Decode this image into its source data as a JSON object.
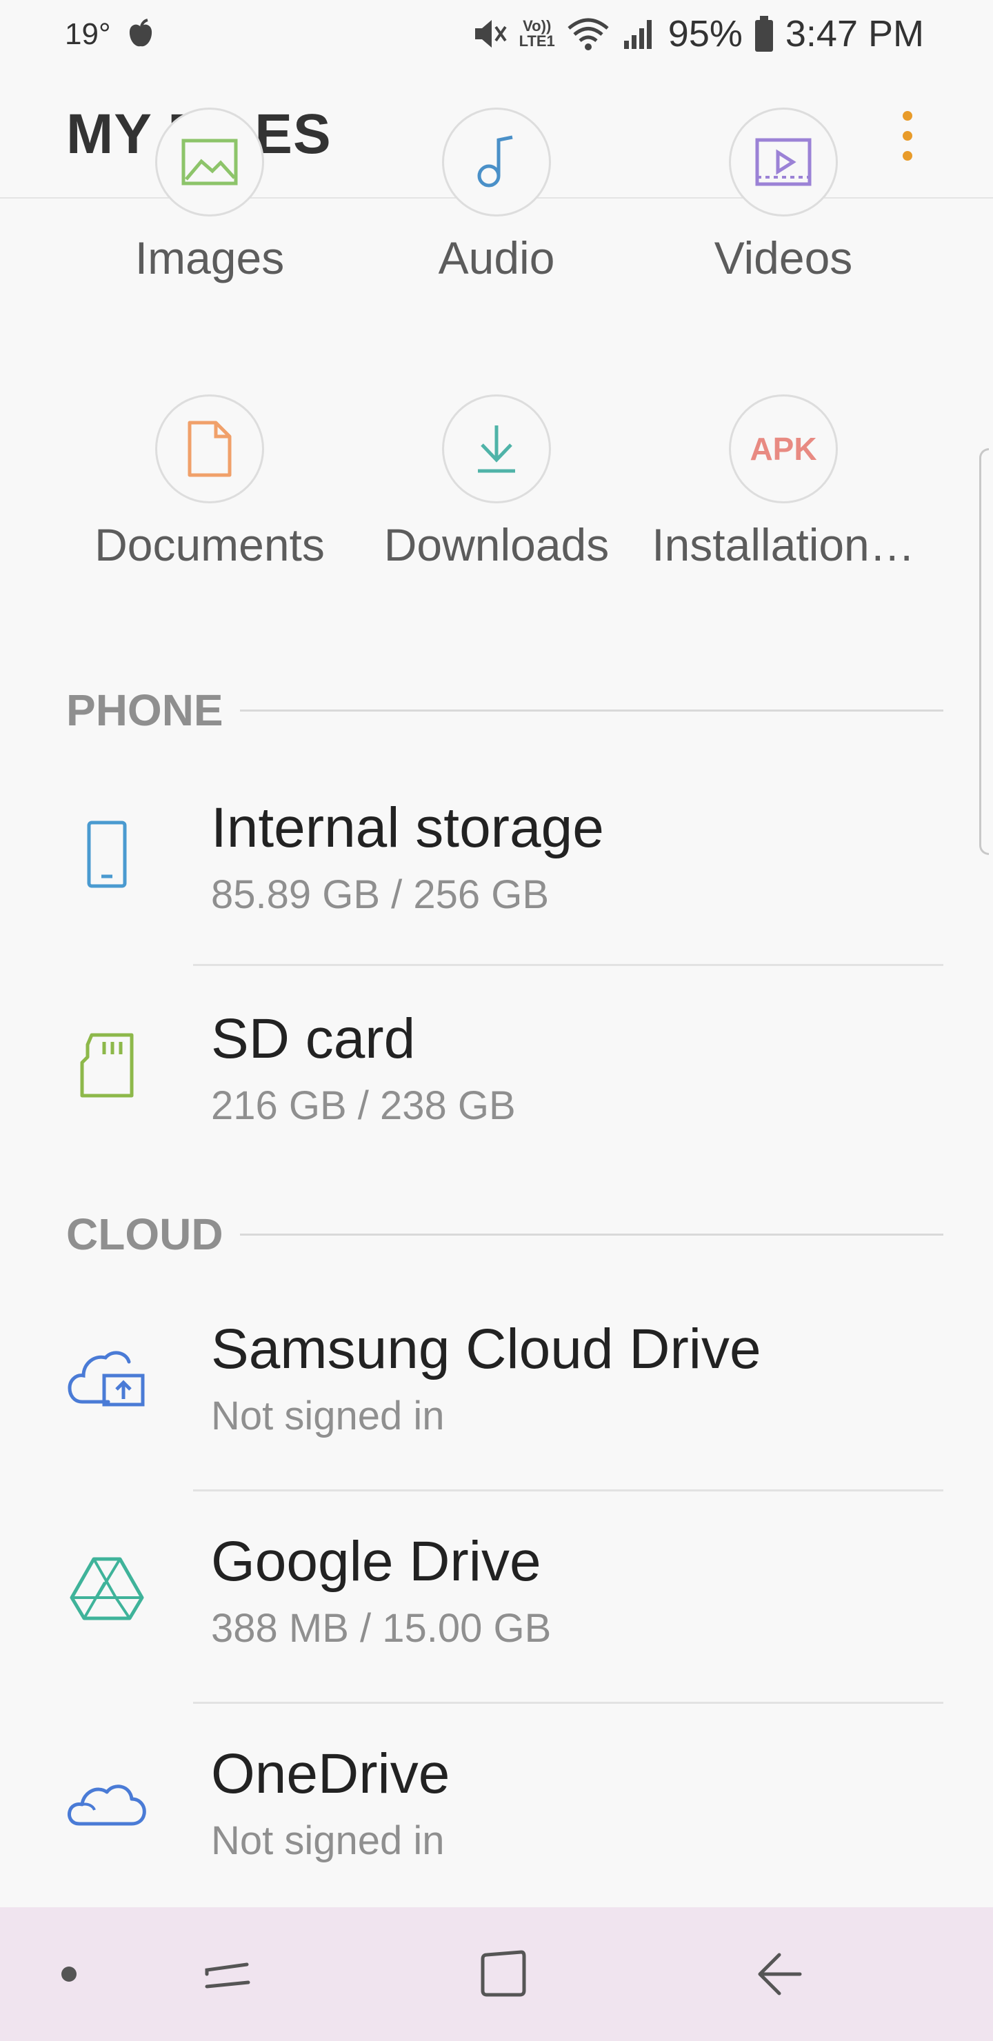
{
  "status_bar": {
    "temperature": "19°",
    "battery_percent": "95%",
    "time": "3:47 PM",
    "icons": [
      "weather-icon",
      "mute-icon",
      "volte-icon",
      "wifi-icon",
      "signal-icon",
      "battery-icon"
    ],
    "volte_line1": "Vo))",
    "volte_line2": "LTE1"
  },
  "app_bar": {
    "title": "MY FILES",
    "accent_color": "#e89b2a"
  },
  "categories": [
    {
      "label": "Images",
      "icon": "image-icon",
      "color": "#8dc46a"
    },
    {
      "label": "Audio",
      "icon": "music-note-icon",
      "color": "#4a90c8"
    },
    {
      "label": "Videos",
      "icon": "video-icon",
      "color": "#9b82d6"
    },
    {
      "label": "Documents",
      "icon": "document-icon",
      "color": "#f0a06a"
    },
    {
      "label": "Downloads",
      "icon": "download-icon",
      "color": "#4fb3a8"
    },
    {
      "label": "Installation…",
      "icon": "apk-icon",
      "icon_text": "APK",
      "color": "#e88a82"
    }
  ],
  "phone_section": {
    "header": "PHONE",
    "items": [
      {
        "name": "Internal storage",
        "sub": "85.89 GB / 256 GB",
        "icon": "phone-icon",
        "color": "#4a9ad0"
      },
      {
        "name": "SD card",
        "sub": "216 GB / 238 GB",
        "icon": "sd-card-icon",
        "color": "#8db84a"
      }
    ]
  },
  "cloud_section": {
    "header": "CLOUD",
    "items": [
      {
        "name": "Samsung Cloud Drive",
        "sub": "Not signed in",
        "icon": "samsung-cloud-icon",
        "color": "#4a7bd6"
      },
      {
        "name": "Google Drive",
        "sub": "388 MB / 15.00 GB",
        "icon": "google-drive-icon",
        "color": "#3fb39a"
      },
      {
        "name": "OneDrive",
        "sub": "Not signed in",
        "icon": "onedrive-icon",
        "color": "#4a7bd6"
      }
    ]
  },
  "nav_bar": {
    "background": "#f0e4ef",
    "buttons": [
      "dot-icon",
      "recents-icon",
      "home-icon",
      "back-icon"
    ]
  }
}
